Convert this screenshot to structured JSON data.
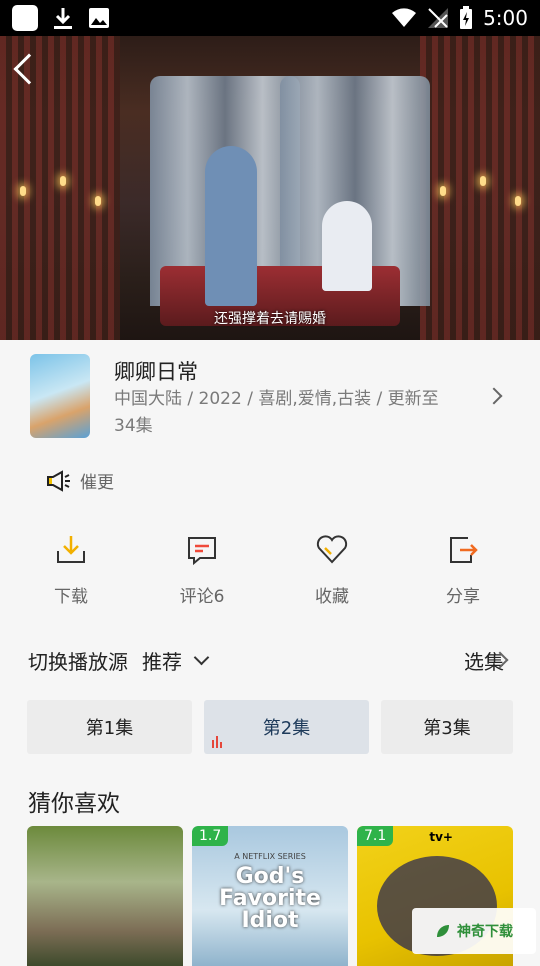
{
  "status_bar": {
    "time": "5:00"
  },
  "video": {
    "subtitle": "还强撑着去请赐婚"
  },
  "drama": {
    "title": "卿卿日常",
    "meta": "中国大陆 / 2022 / 喜剧,爱情,古装 / 更新至34集"
  },
  "urge": {
    "label": "催更"
  },
  "actions": [
    {
      "label": "下载",
      "icon": "download-icon"
    },
    {
      "label": "评论6",
      "icon": "comment-icon"
    },
    {
      "label": "收藏",
      "icon": "heart-icon"
    },
    {
      "label": "分享",
      "icon": "share-icon"
    }
  ],
  "source": {
    "label": "切换播放源",
    "value": "推荐",
    "pick_label": "选集"
  },
  "episodes": [
    {
      "label": "第1集",
      "active": false
    },
    {
      "label": "第2集",
      "active": true
    },
    {
      "label": "第3集",
      "active": false
    }
  ],
  "recommend": {
    "title": "猜你喜欢",
    "items": [
      {
        "score": ""
      },
      {
        "score": "1.7",
        "poster_text": "God's Favorite Idiot",
        "badge": "A NETFLIX SERIES"
      },
      {
        "score": "7.1",
        "badge": "tv+"
      }
    ]
  },
  "watermark": {
    "text": "神奇下载"
  },
  "colors": {
    "score_badge": "#2fb34a",
    "playing": "#e5473b",
    "active_episode": "#dde2e8"
  }
}
